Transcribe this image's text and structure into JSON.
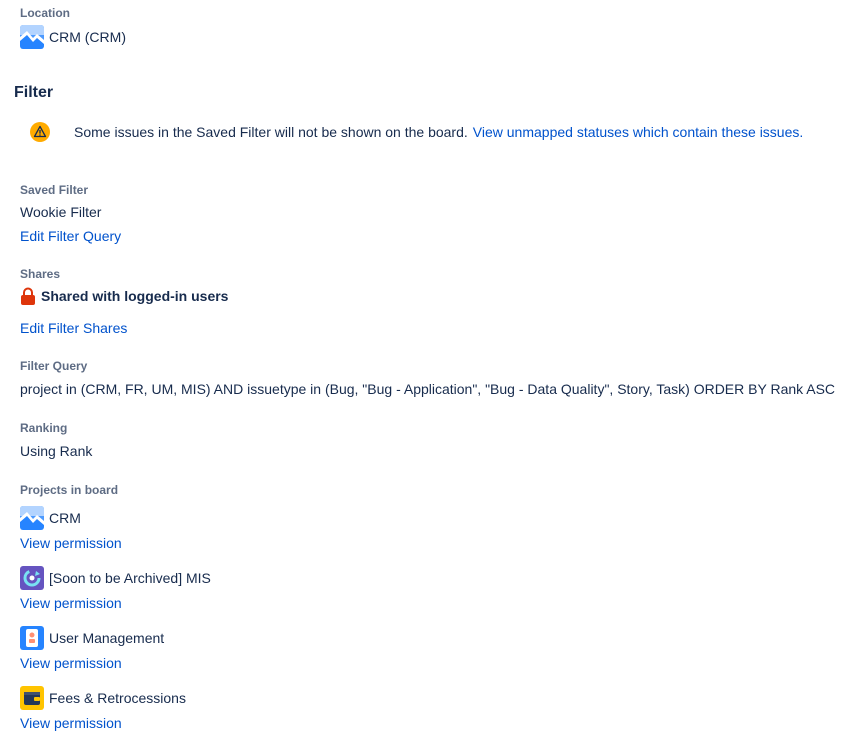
{
  "location": {
    "label": "Location",
    "value": "CRM (CRM)",
    "icon": "crm-project-avatar"
  },
  "filter": {
    "heading": "Filter",
    "warning": {
      "text": "Some issues in the Saved Filter will not be shown on the board.",
      "link": "View unmapped statuses which contain these issues.",
      "icon": "warning-icon",
      "color": "#ffab00"
    },
    "saved_filter": {
      "label": "Saved Filter",
      "value": "Wookie Filter",
      "edit_link": "Edit Filter Query"
    },
    "shares": {
      "label": "Shares",
      "value": "Shared with logged-in users",
      "icon": "lock-icon",
      "icon_color": "#de350b",
      "edit_link": "Edit Filter Shares"
    },
    "filter_query": {
      "label": "Filter Query",
      "value": "project in (CRM, FR, UM, MIS) AND issuetype in (Bug, \"Bug - Application\", \"Bug - Data Quality\", Story, Task) ORDER BY Rank ASC"
    },
    "ranking": {
      "label": "Ranking",
      "value": "Using Rank"
    }
  },
  "projects": {
    "label": "Projects in board",
    "items": [
      {
        "name": "CRM",
        "link": "View permission",
        "icon": "crm-project-avatar"
      },
      {
        "name": "[Soon to be Archived] MIS",
        "link": "View permission",
        "icon": "mis-project-avatar"
      },
      {
        "name": "User Management",
        "link": "View permission",
        "icon": "user-management-project-avatar"
      },
      {
        "name": "Fees & Retrocessions",
        "link": "View permission",
        "icon": "fees-project-avatar"
      }
    ]
  },
  "colors": {
    "text": "#172b4d",
    "subtle": "#5e6c84",
    "link": "#0052cc"
  }
}
